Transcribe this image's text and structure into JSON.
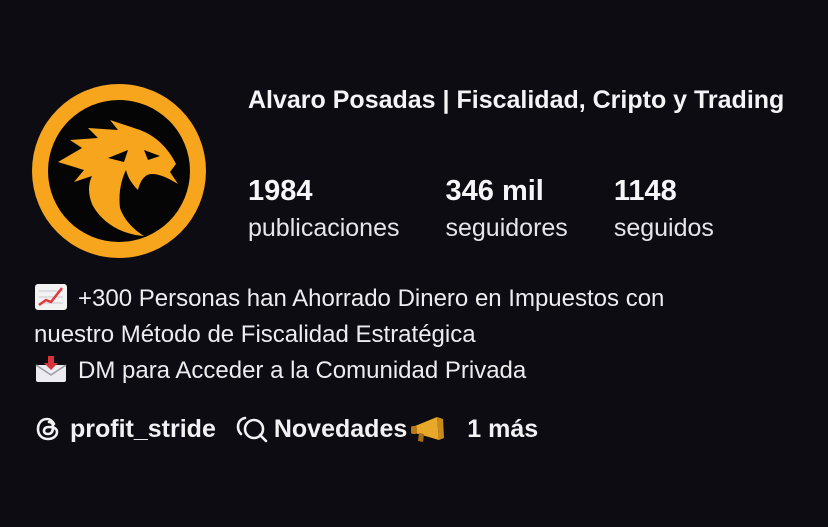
{
  "profile": {
    "name": "Alvaro Posadas | Fiscalidad, Cripto y Trading",
    "avatar_icon": "eagle-logo-icon",
    "colors": {
      "background": "#0c0c12",
      "avatar_ring": "#f6a51c",
      "text": "#ffffff"
    }
  },
  "stats": {
    "posts": {
      "value": "1984",
      "label": "publicaciones"
    },
    "followers": {
      "value": "346 mil",
      "label": "seguidores"
    },
    "following": {
      "value": "1148",
      "label": "seguidos"
    }
  },
  "bio": {
    "line1_icon": "chart-increasing-emoji",
    "line1": "+300 Personas han Ahorrado Dinero en Impuestos con",
    "line2": "nuestro Método de Fiscalidad Estratégica",
    "line3_icon": "envelope-with-arrow-emoji",
    "line3": "DM para Acceder a la Comunidad Privada"
  },
  "links": {
    "threads_icon": "threads-icon",
    "threads_handle": "profit_stride",
    "novedades_icon": "channel-icon",
    "novedades_label": "Novedades",
    "novedades_emoji": "megaphone-emoji",
    "more_label": "1 más"
  }
}
